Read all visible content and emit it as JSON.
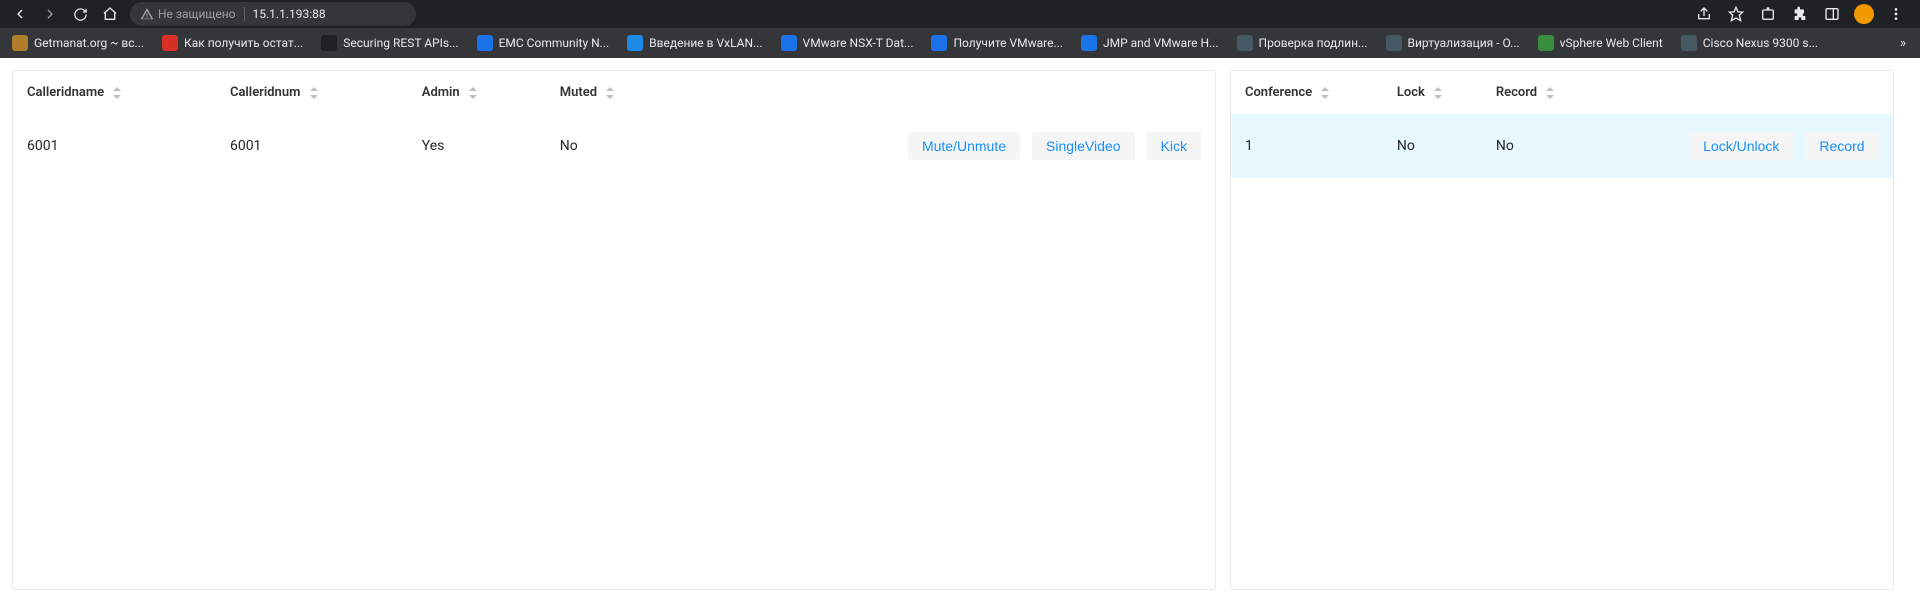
{
  "browser": {
    "security_text": "Не защищено",
    "address": "15.1.1.193:88",
    "bookmarks": [
      {
        "label": "Getmanat.org ~ вс...",
        "color": "#b07d2b"
      },
      {
        "label": "Как получить остат...",
        "color": "#d93025"
      },
      {
        "label": "Securing REST APIs...",
        "color": "#202124"
      },
      {
        "label": "EMC Community N...",
        "color": "#1a73e8"
      },
      {
        "label": "Введение в VxLAN...",
        "color": "#1e88e5"
      },
      {
        "label": "VMware NSX-T Dat...",
        "color": "#1a73e8"
      },
      {
        "label": "Получите VMware...",
        "color": "#1a73e8"
      },
      {
        "label": "JMP and VMware H...",
        "color": "#1a73e8"
      },
      {
        "label": "Проверка подлин...",
        "color": "#455a64"
      },
      {
        "label": "Виртуализация - О...",
        "color": "#455a64"
      },
      {
        "label": "vSphere Web Client",
        "color": "#388e3c"
      },
      {
        "label": "Cisco Nexus 9300 s...",
        "color": "#455a64"
      }
    ]
  },
  "participants": {
    "headers": {
      "calleridname": "Calleridname",
      "calleridnum": "Calleridnum",
      "admin": "Admin",
      "muted": "Muted"
    },
    "rows": [
      {
        "calleridname": "6001",
        "calleridnum": "6001",
        "admin": "Yes",
        "muted": "No"
      }
    ],
    "actions": {
      "mute": "Mute/Unmute",
      "singlevideo": "SingleVideo",
      "kick": "Kick"
    }
  },
  "conferences": {
    "headers": {
      "conference": "Conference",
      "lock": "Lock",
      "record": "Record"
    },
    "rows": [
      {
        "conference": "1",
        "lock": "No",
        "record": "No"
      }
    ],
    "actions": {
      "lock": "Lock/Unlock",
      "record": "Record"
    }
  }
}
